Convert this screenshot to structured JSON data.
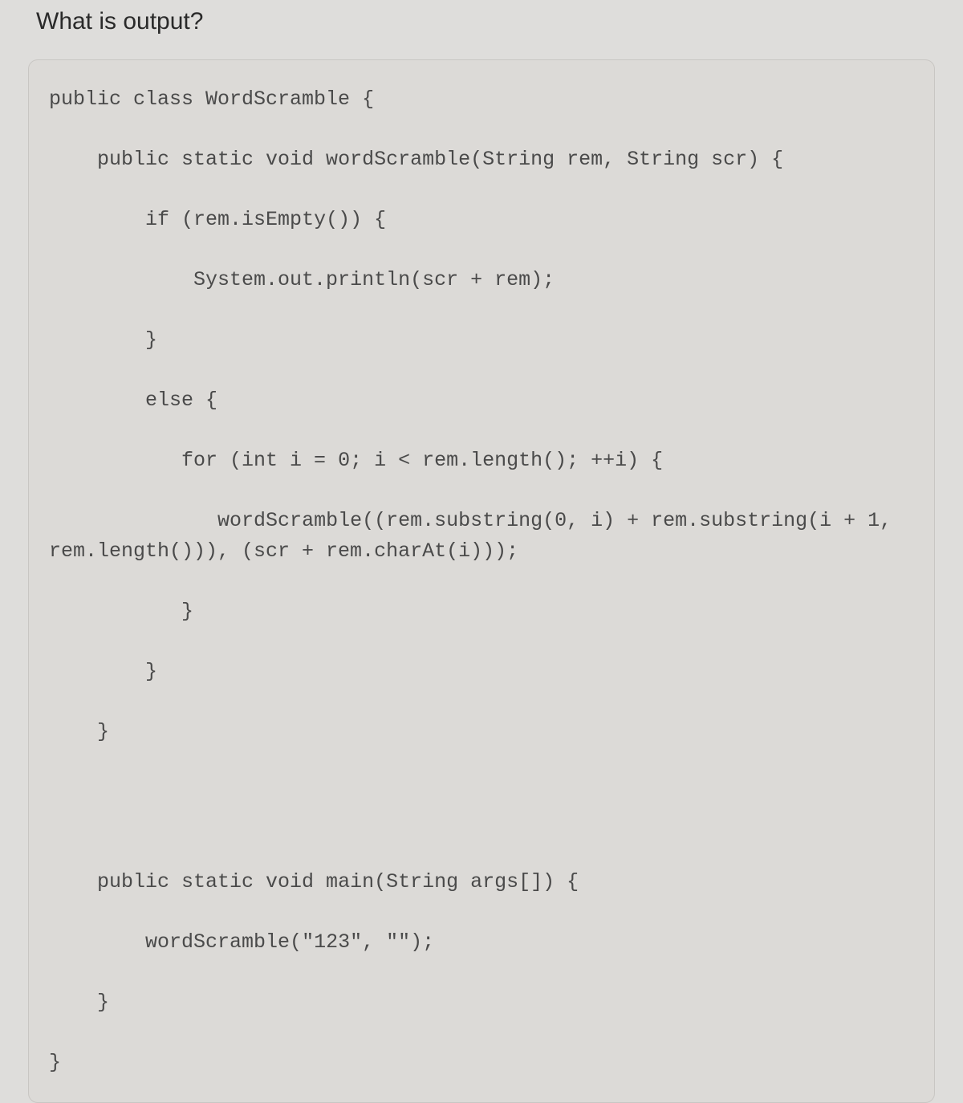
{
  "question": {
    "title": "What is output?"
  },
  "code": {
    "lines": "public class WordScramble {\n\n    public static void wordScramble(String rem, String scr) {\n\n        if (rem.isEmpty()) {\n\n            System.out.println(scr + rem);\n\n        }\n\n        else {\n\n           for (int i = 0; i < rem.length(); ++i) {\n\n              wordScramble((rem.substring(0, i) + rem.substring(i + 1, rem.length())), (scr + rem.charAt(i)));\n\n           }\n\n        }\n\n    }\n\n\n\n\n    public static void main(String args[]) {\n\n        wordScramble(\"123\", \"\");\n\n    }\n\n}"
  }
}
